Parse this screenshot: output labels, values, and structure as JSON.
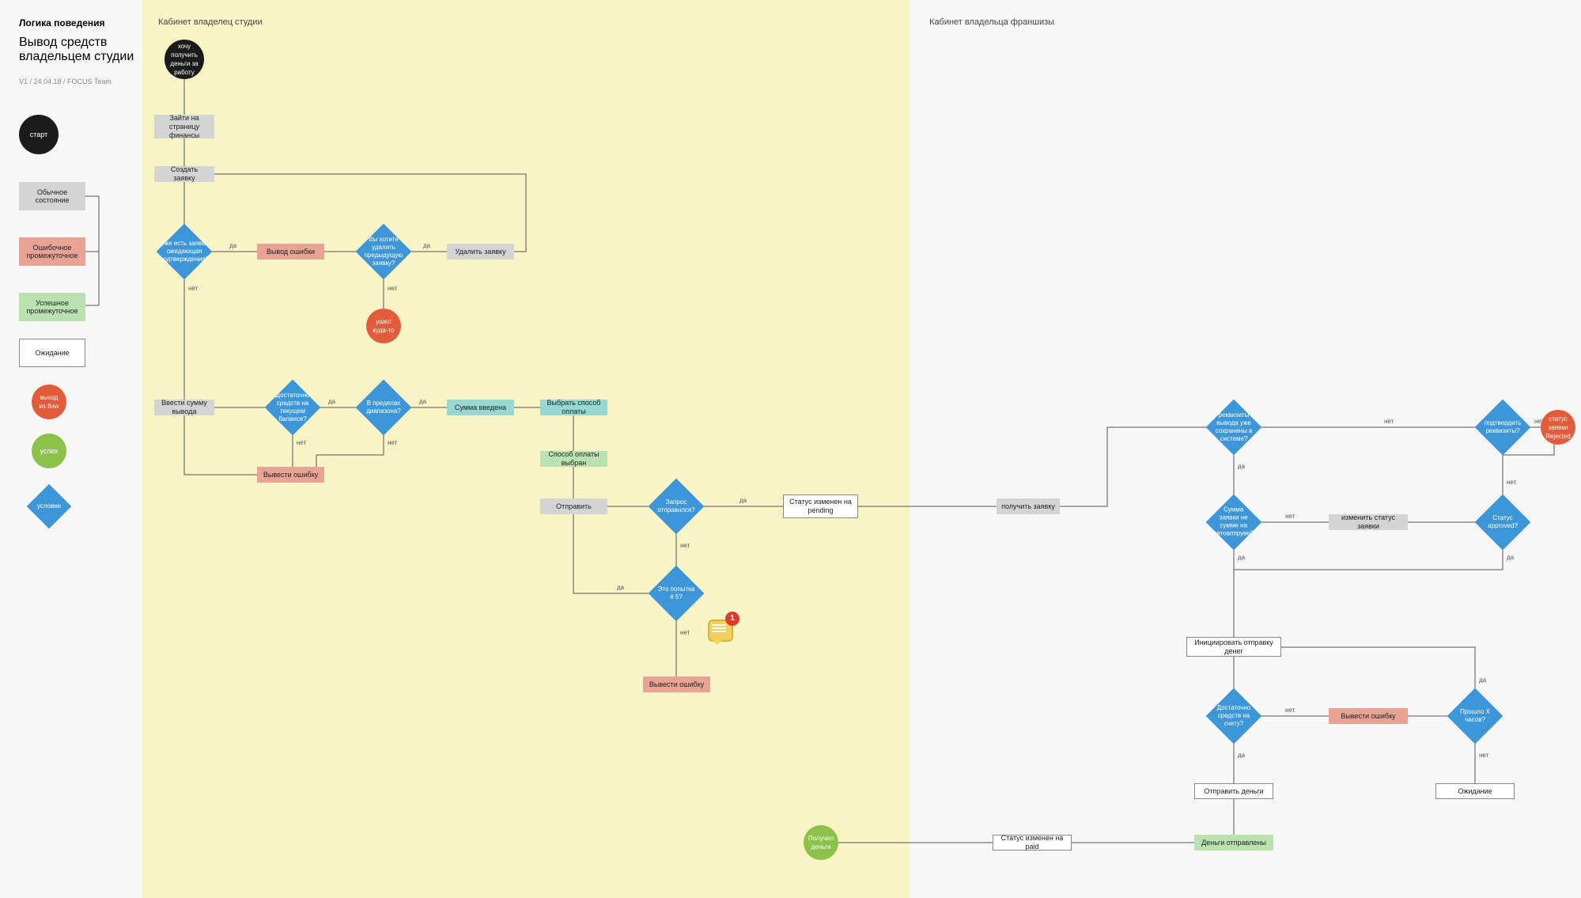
{
  "sidebar": {
    "heading": "Логика поведения",
    "title_l1": "Вывод средств",
    "title_l2": "владельцем студии",
    "meta": "V1 / 24.04.18 / FOCUS Team",
    "legend": {
      "start": "старт",
      "normal": "Обычное состояние",
      "error": "Ошибочное промежуточное",
      "success": "Успешное промежуточное",
      "wait": "Ожидание",
      "exit": "выход из flow",
      "done": "успех",
      "cond": "условие"
    }
  },
  "headings": {
    "left": "Кабинет владелец студии",
    "right": "Кабинет владельца франшизы"
  },
  "nodes": {
    "start": "хочу получить деньги за работу",
    "r1": "Зайти на страницу финансы",
    "r2": "Создать заявку",
    "d1": "Уже есть заявка ожидающая подтверждения?",
    "e1": "Вывод ошибки",
    "d2": "Вы хотите удалить предыдущую заявку?",
    "r3": "Удалить заявку",
    "exit1": "ушел куда-то",
    "r4": "Ввести сумму вывода",
    "d3": "Достаточно средств на текущем балансе?",
    "d4": "В пределах диапазона?",
    "e2": "Вывести ошибку",
    "t1": "Сумма введена",
    "t2": "Выбрать способ оплаты",
    "g1": "Способ оплаты выбран",
    "r5": "Отправить",
    "d5": "Запрос отправился?",
    "d6": "Это попытка # 5?",
    "e3": "Вывести ошибку",
    "w1": "Статус изменен на pending",
    "r6": "получить заявку",
    "d7": "реквизиты вывода уже сохранены в системе?",
    "d8": "подтвердить реквизиты?",
    "exit2": "статус заявки Rejected",
    "d9": "Сумма заявки не сумме на автоаппруве?",
    "r7": "изменить статус заявки",
    "d10": "Статус approved?",
    "w2": "Инициировать отправку денег",
    "d11": "Достаточно средств на счету?",
    "e4": "Вывести ошибку",
    "d12": "Прошло X часов?",
    "w3": "Отправить деньги",
    "w4": "Ожидание",
    "g2": "Деньги отправлены",
    "w5": "Статус изменен на paid",
    "done": "Получил деньги"
  },
  "labels": {
    "yes": "да",
    "no": "нет"
  },
  "comment": {
    "count": "1"
  }
}
